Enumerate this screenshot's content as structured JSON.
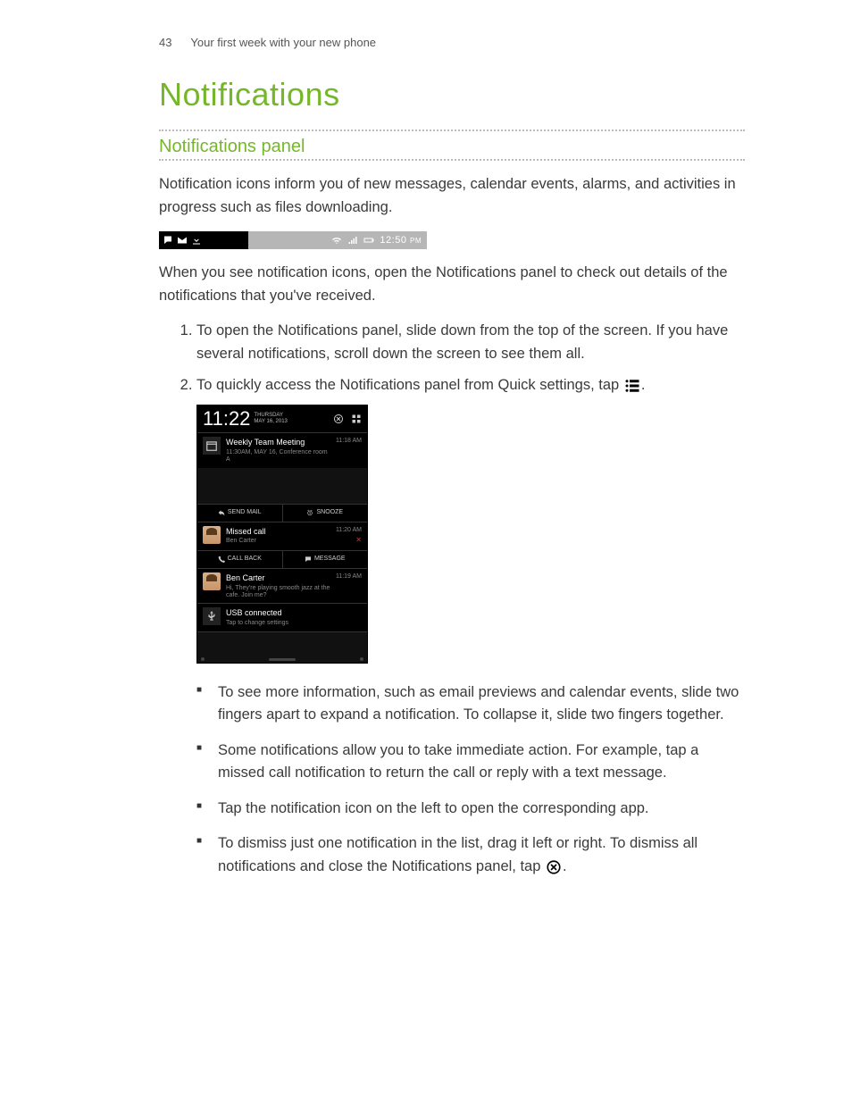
{
  "header": {
    "page_number": "43",
    "section": "Your first week with your new phone"
  },
  "title": "Notifications",
  "subtitle": "Notifications panel",
  "intro": "Notification icons inform you of new messages, calendar events, alarms, and activities in progress such as files downloading.",
  "statusbar": {
    "time": "12:50",
    "ampm": "PM"
  },
  "after_bar": "When you see notification icons, open the Notifications panel to check out details of the notifications that you've received.",
  "steps": {
    "s1": "To open the Notifications panel, slide down from the top of the screen. If you have several notifications, scroll down the screen to see them all.",
    "s2_pre": "To quickly access the Notifications panel from Quick settings, tap ",
    "s2_post": "."
  },
  "phone": {
    "clock": "11:22",
    "day": "THURSDAY",
    "date": "MAY 16, 2013",
    "n1": {
      "title": "Weekly Team Meeting",
      "sub": "11:30AM, MAY 16, Conference room A",
      "time": "11:18 AM",
      "a1": "SEND MAIL",
      "a2": "SNOOZE"
    },
    "n2": {
      "title": "Missed call",
      "sub": "Ben Carter",
      "time": "11:20 AM",
      "a1": "CALL BACK",
      "a2": "MESSAGE"
    },
    "n3": {
      "title": "Ben Carter",
      "sub": "Hi, They're playing smooth jazz at the cafe. Join me?",
      "time": "11:19 AM"
    },
    "n4": {
      "title": "USB connected",
      "sub": "Tap to change settings"
    }
  },
  "tips": {
    "t1": "To see more information, such as email previews and calendar events, slide two fingers apart to expand a notification. To collapse it, slide two fingers together.",
    "t2": "Some notifications allow you to take immediate action. For example, tap a missed call notification to return the call or reply with a text message.",
    "t3": "Tap the notification icon on the left to open the corresponding app.",
    "t4_pre": "To dismiss just one notification in the list, drag it left or right. To dismiss all notifications and close the Notifications panel, tap ",
    "t4_post": "."
  }
}
